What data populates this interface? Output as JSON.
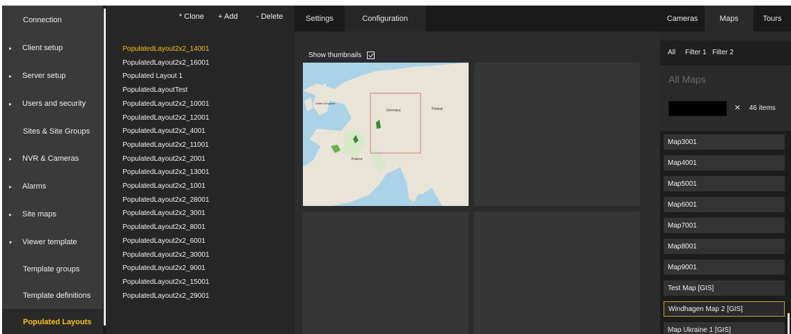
{
  "nav": {
    "items": [
      {
        "label": "Connection",
        "arrow": ""
      },
      {
        "label": "Client setup",
        "arrow": "▸"
      },
      {
        "label": "Server setup",
        "arrow": "▸"
      },
      {
        "label": "Users and security",
        "arrow": "▸"
      },
      {
        "label": "Sites & Site Groups",
        "arrow": ""
      },
      {
        "label": "NVR & Cameras",
        "arrow": "▸"
      },
      {
        "label": "Alarms",
        "arrow": "▸"
      },
      {
        "label": "Site maps",
        "arrow": "▸"
      },
      {
        "label": "Viewer template",
        "arrow": "▾"
      },
      {
        "label": "Template groups",
        "arrow": ""
      },
      {
        "label": "Template definitions",
        "arrow": ""
      },
      {
        "label": "Populated Layouts",
        "arrow": "",
        "active": true
      }
    ]
  },
  "toolbar": {
    "clone_label": "* Clone",
    "add_label": "+ Add",
    "delete_label": "- Delete"
  },
  "layouts": [
    "PopulatedLayout2x2_14001",
    "PopulatedLayout2x2_16001",
    "Populated Layout 1",
    "PopulatedLayoutTest",
    "PopulatedLayout2x2_10001",
    "PopulatedLayout2x2_12001",
    "PopulatedLayout2x2_4001",
    "PopulatedLayout2x2_11001",
    "PopulatedLayout2x2_2001",
    "PopulatedLayout2x2_13001",
    "PopulatedLayout2x2_1001",
    "PopulatedLayout2x2_28001",
    "PopulatedLayout2x2_3001",
    "PopulatedLayout2x2_8001",
    "PopulatedLayout2x2_6001",
    "PopulatedLayout2x2_30001",
    "PopulatedLayout2x2_9001",
    "PopulatedLayout2x2_15001",
    "PopulatedLayout2x2_29001"
  ],
  "center": {
    "tabs": [
      "Settings",
      "Configuration"
    ],
    "active_tab": "Configuration",
    "show_thumbnails_label": "Show thumbnails",
    "show_thumbnails_checked": true,
    "map_labels": [
      "Germany",
      "Poland",
      "France",
      "United Kingdom"
    ]
  },
  "right": {
    "tabs": [
      "Cameras",
      "Maps",
      "Tours"
    ],
    "active_tab": "Maps",
    "filters": [
      "All",
      "Filter 1",
      "Filter 2"
    ],
    "heading": "All Maps",
    "search_value": "",
    "clear_icon": "×",
    "count_label": "46 items",
    "maps": [
      "Map3001",
      "Map4001",
      "Map5001",
      "Map6001",
      "Map7001",
      "Map8001",
      "Map9001",
      "Test Map [GIS]",
      "Windhagen Map 2 [GIS]",
      "Map Ukraine 1 [GIS]"
    ],
    "selected_map": "Windhagen Map 2 [GIS]"
  },
  "colors": {
    "accent": "#f6c200",
    "background": "#1e1e1e",
    "nav_bg": "#3a3a3a"
  }
}
